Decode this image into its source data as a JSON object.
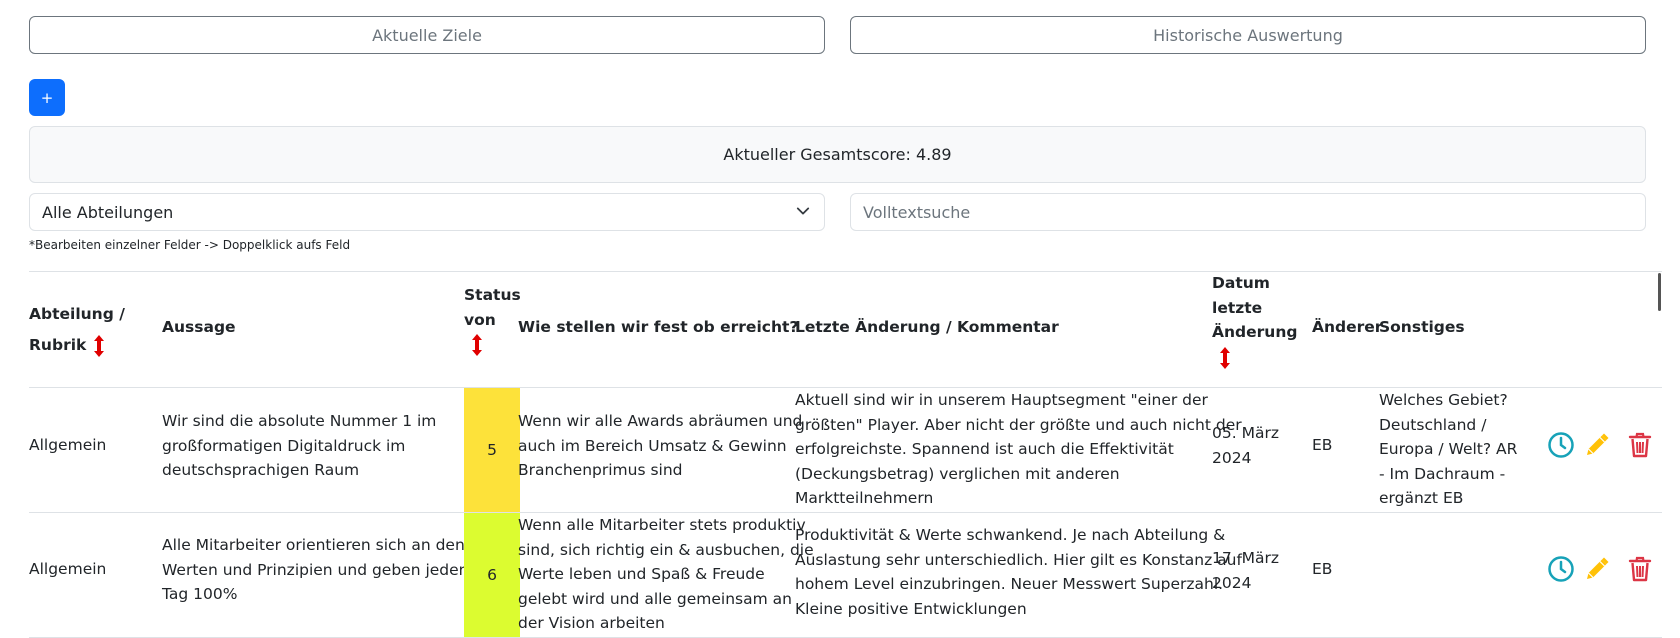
{
  "tabs": {
    "current": "Aktuelle Ziele",
    "history": "Historische Auswertung"
  },
  "add_button": "+",
  "score": {
    "text": "Aktueller Gesamtscore: 4.89"
  },
  "filter": {
    "department": "Alle Abteilungen",
    "search_placeholder": "Volltextsuche"
  },
  "hint": "*Bearbeiten einzelner Felder -> Doppelklick aufs Feld",
  "table": {
    "headers": {
      "department_l1": "Abteilung /",
      "department_l2": "Rubrik",
      "statement": "Aussage",
      "status_l1": "Status",
      "status_l2": "von",
      "measure": "Wie stellen wir fest ob erreicht?",
      "last_change": "Letzte Änderung / Kommentar",
      "date_l1": "Datum",
      "date_l2": "letzte",
      "date_l3": "Änderung",
      "editor": "Änderer",
      "misc": "Sonstiges"
    },
    "rows": [
      {
        "department": "Allgemein",
        "statement": [
          "Wir sind die absolute Nummer 1 im",
          "großformatigen Digitaldruck im",
          "deutschsprachigen Raum"
        ],
        "status": "5",
        "status_color": "#fde23a",
        "measure": [
          "Wenn wir alle Awards abräumen und",
          "auch im Bereich Umsatz & Gewinn",
          "Branchenprimus sind"
        ],
        "comment": [
          "Aktuell sind wir in unserem Hauptsegment \"einer der",
          "größten\" Player. Aber nicht der größte und auch nicht der",
          "erfolgreichste. Spannend ist auch die Effektivität",
          "(Deckungsbetrag) verglichen mit anderen",
          "Marktteilnehmern"
        ],
        "date": [
          "05. März",
          "2024"
        ],
        "editor": "EB",
        "misc": [
          "Welches Gebiet?",
          "Deutschland /",
          "Europa / Welt? AR",
          "- Im Dachraum -",
          "ergänzt EB"
        ]
      },
      {
        "department": "Allgemein",
        "statement": [
          "Alle Mitarbeiter orientieren sich an den",
          "Werten und Prinzipien und geben jeden",
          "Tag 100%"
        ],
        "status": "6",
        "status_color": "#dcfc30",
        "measure": [
          "Wenn alle Mitarbeiter stets produktiv",
          "sind, sich richtig ein & ausbuchen, die",
          "Werte leben und Spaß & Freude",
          "gelebt wird und alle gemeinsam an",
          "der Vision arbeiten"
        ],
        "comment": [
          "Produktivität & Werte schwankend. Je nach Abteilung &",
          "Auslastung sehr unterschiedlich. Hier gilt es Konstanz auf",
          "hohem Level einzubringen. Neuer Messwert Superzahl.",
          "Kleine positive Entwicklungen"
        ],
        "date": [
          "17. März",
          "2024"
        ],
        "editor": "EB",
        "misc": []
      }
    ]
  },
  "colors": {
    "primary": "#0d6efd",
    "history_icon": "#17a2b8",
    "edit_icon": "#ffc107",
    "delete_icon": "#dc3545",
    "sort_arrow": "#e00000"
  },
  "icons": {
    "history": "clock-icon",
    "edit": "pencil-icon",
    "delete": "trash-icon",
    "sort": "sort-arrow-icon"
  }
}
